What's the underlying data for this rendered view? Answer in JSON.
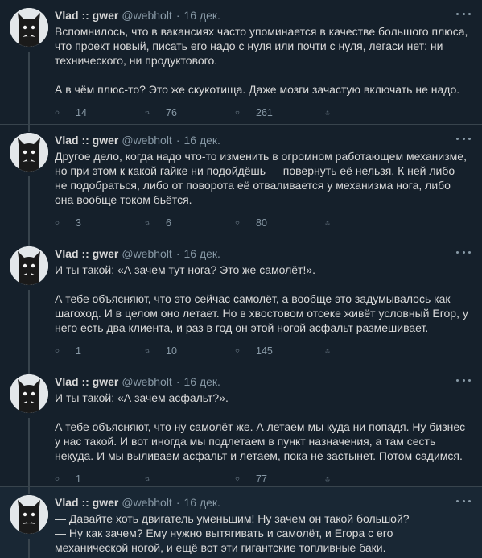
{
  "tweets": [
    {
      "name": "Vlad :: gwer",
      "handle": "@webholt",
      "separator": "·",
      "date": "16 дек.",
      "text": "Вспомнилось, что в вакансиях часто упоминается в качестве большого плюса, что проект новый, писать его надо с нуля или почти с нуля, легаси нет: ни технического, ни продуктового.\n\nА в чём плюс-то? Это же скукотища. Даже мозги зачастую включать не надо.",
      "replies": "14",
      "retweets": "76",
      "likes": "261"
    },
    {
      "name": "Vlad :: gwer",
      "handle": "@webholt",
      "separator": "·",
      "date": "16 дек.",
      "text": "Другое дело, когда надо что-то изменить в огромном работающем механизме, но при этом к какой гайке ни подойдёшь — повернуть её нельзя. К ней либо не подобраться, либо от поворота её отваливается у механизма нога, либо она вообще током бьётся.",
      "replies": "3",
      "retweets": "6",
      "likes": "80"
    },
    {
      "name": "Vlad :: gwer",
      "handle": "@webholt",
      "separator": "·",
      "date": "16 дек.",
      "text": "И ты такой: «А зачем тут нога? Это же самолёт!».\n\nА тебе объясняют, что это сейчас самолёт, а вообще это задумывалось как шагоход. И в целом оно летает. Но в хвостовом отсеке живёт условный Егор, у него есть два клиента, и раз в год он этой ногой асфальт размешивает.",
      "replies": "1",
      "retweets": "10",
      "likes": "145"
    },
    {
      "name": "Vlad :: gwer",
      "handle": "@webholt",
      "separator": "·",
      "date": "16 дек.",
      "text": "И ты такой: «А зачем асфальт?».\n\nА тебе объясняют, что ну самолёт же. А летаем мы куда ни попадя. Ну бизнес у нас такой. И вот иногда мы подлетаем в пункт назначения, а там сесть некуда. И мы выливаем асфальт и летаем, пока не застынет. Потом садимся.",
      "replies": "1",
      "retweets": "",
      "likes": "77"
    },
    {
      "name": "Vlad :: gwer",
      "handle": "@webholt",
      "separator": "·",
      "date": "16 дек.",
      "text": "— Давайте хоть двигатель уменьшим! Ну зачем он такой большой?\n— Ну как зачем? Ему нужно вытягивать и самолёт, и Егора с его механической ногой, и ещё вот эти гигантские топливные баки.",
      "replies": "",
      "retweets": "",
      "likes": ""
    }
  ],
  "colors": {
    "background": "#15202b",
    "border": "#38444d",
    "text": "#d9d9d9",
    "muted": "#8899a6"
  },
  "icons": [
    "avatar-cat",
    "more-dots-icon",
    "reply-icon",
    "retweet-icon",
    "like-icon",
    "share-icon"
  ]
}
